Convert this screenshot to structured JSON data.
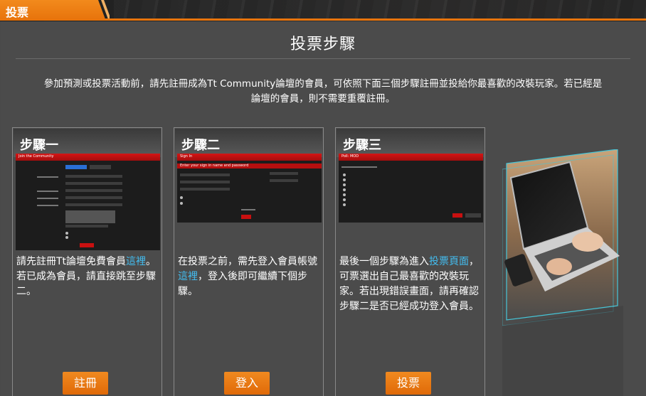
{
  "header": {
    "tab_label": "投票"
  },
  "main": {
    "title": "投票步驟",
    "intro_line1": "參加預測或投票活動前，請先註冊成為Tt Community論壇的會員，可依照下面三個步驟註冊並投給你最喜歡的改裝玩家。若已經是",
    "intro_line2": "論壇的會員，則不需要重覆註冊。"
  },
  "steps": [
    {
      "title": "步驟一",
      "screenshot_header": "Join the Community",
      "text_before": "請先註冊Tt論壇免費會員",
      "link": "這裡",
      "text_after": "。若已成為會員，請直接跳至步驟二。",
      "button": "註冊"
    },
    {
      "title": "步驟二",
      "screenshot_header": "Sign In",
      "screenshot_subheader": "Enter your sign in name and password",
      "text_before": "在投票之前，需先登入會員帳號",
      "link": "這裡",
      "text_after": "，登入後即可繼續下個步驟。",
      "button": "登入"
    },
    {
      "title": "步驟三",
      "screenshot_header": "Poll: MOD",
      "text_before": "最後一個步驟為進入",
      "link": "投票頁面",
      "text_after": "，可票選出自己最喜歡的改裝玩家。若出現錯誤畫面，請再確認步驟二是否已經成功登入會員。",
      "button": "投票"
    }
  ],
  "colors": {
    "accent": "#e8740c",
    "link": "#43bdf0",
    "background": "#4b4b4b"
  }
}
